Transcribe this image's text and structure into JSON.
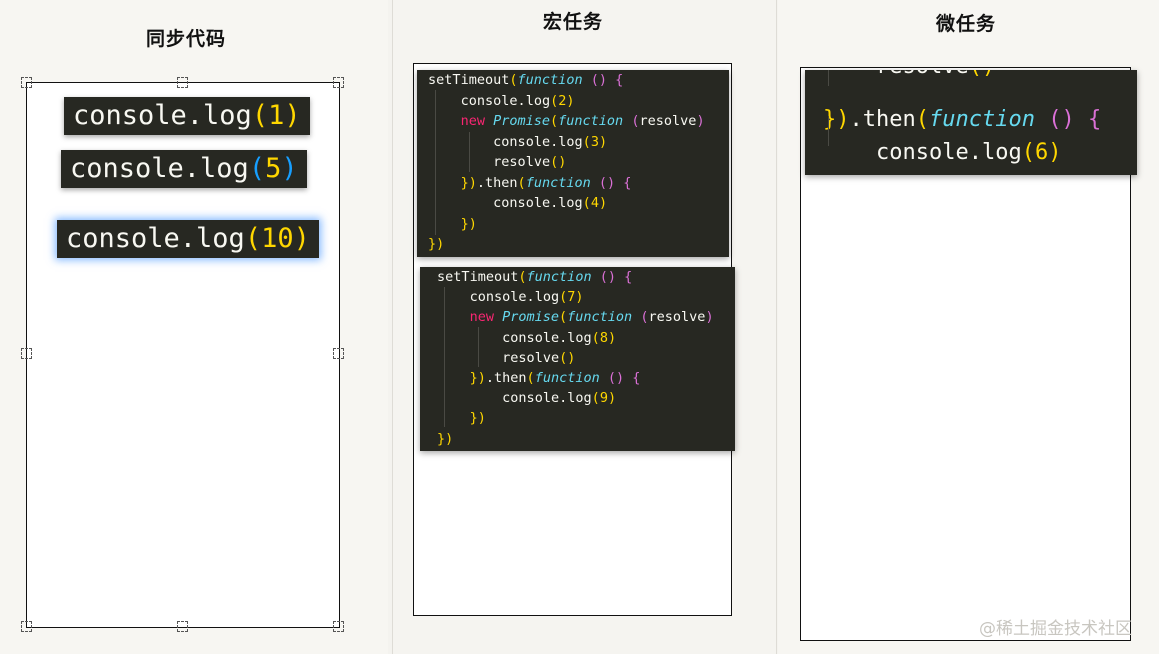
{
  "columns": {
    "sync": {
      "title": "同步代码"
    },
    "macro": {
      "title": "宏任务"
    },
    "micro": {
      "title": "微任务"
    }
  },
  "sync_chips": [
    {
      "prefix": "console.log",
      "open": "(",
      "value": "1",
      "close": ")"
    },
    {
      "prefix": "console.log",
      "open": "(",
      "value": "5",
      "close": ")"
    },
    {
      "prefix": "console.log",
      "open": "(",
      "value": "10",
      "close": ")"
    }
  ],
  "macro_blocks": [
    {
      "lines": [
        "setTimeout(function () {",
        "    console.log(2)",
        "    new Promise(function (resolve)",
        "        console.log(3)",
        "        resolve()",
        "    }).then(function () {",
        "        console.log(4)",
        "    })",
        "})"
      ]
    },
    {
      "lines": [
        "setTimeout(function () {",
        "    console.log(7)",
        "    new Promise(function (resolve)",
        "        console.log(8)",
        "        resolve()",
        "    }).then(function () {",
        "        console.log(9)",
        "    })",
        "})"
      ]
    }
  ],
  "micro_block": {
    "lines": [
      "    resolve()",
      "}).then(function () {",
      "    console.log(6)",
      "})"
    ]
  },
  "watermark": "@稀土掘金技术社区"
}
